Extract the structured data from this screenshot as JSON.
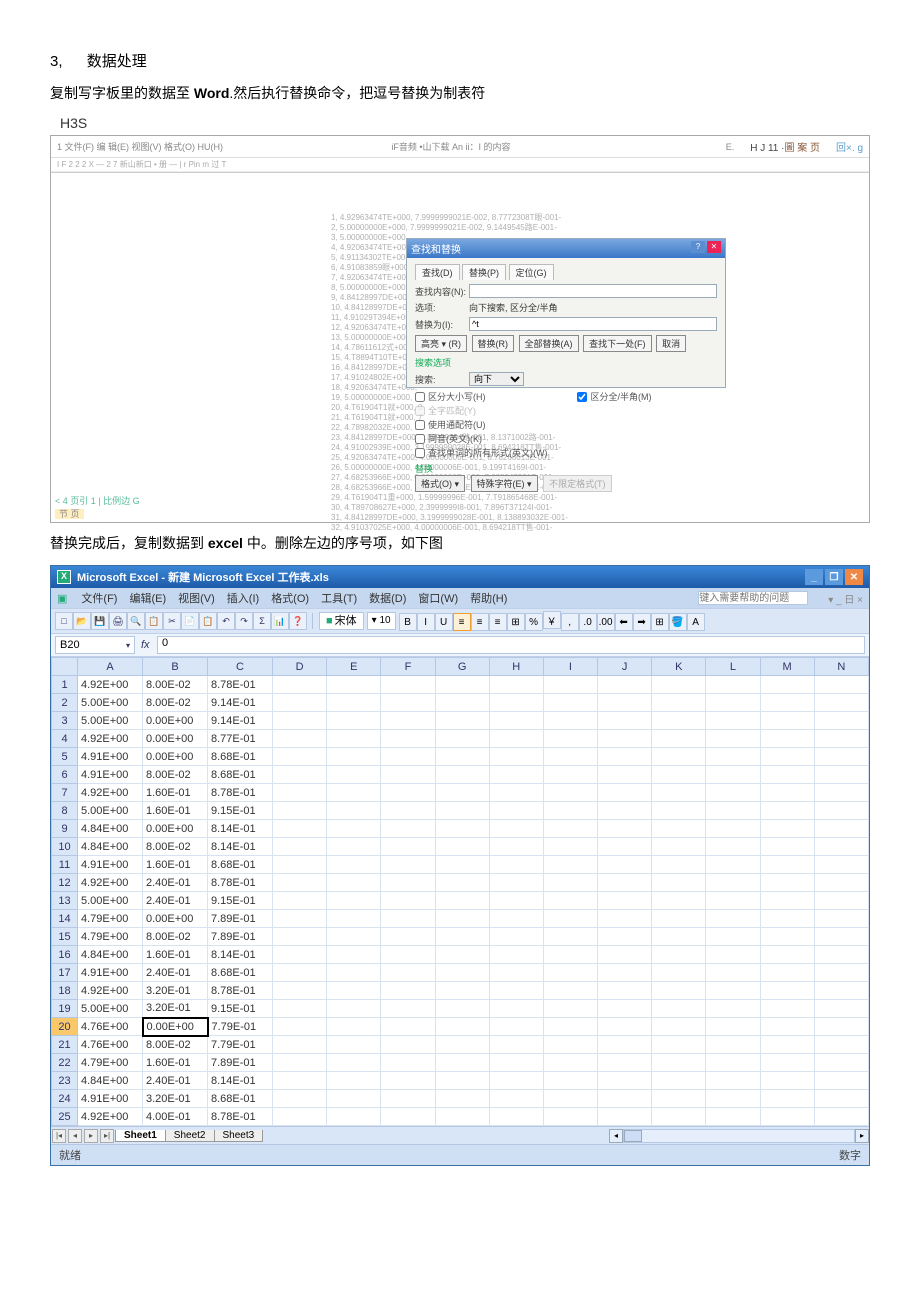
{
  "heading": {
    "num": "3,",
    "text": "数据处理"
  },
  "para1": {
    "a": "复制写字板里的数据至 ",
    "b": "Word",
    "c": ".然后执行替换命令，把逗号替换为制表符"
  },
  "h3s": "H3S",
  "word": {
    "menu_left": "1 文件(F)    编 辑(E) 视图(V) 格式(O) HU(H)",
    "menu_mid": "iF音频   •山下载   An ii：I 的内容",
    "menu_sub": "I F 2 2 2 X — 2 7 新山新口 • 册 — | r Pin m 过 T",
    "hj": "H J 11 ·",
    "hj2": "圖 案  页",
    "g": "回×. g",
    "e": "E.",
    "text_lines": [
      "1, 4.92963474TE+000, 7.9999999021E-002, 8.7772308T眼-001-",
      "2, 5.00000000E+000, 7.9999999021E-002, 9.1449545路E-001-",
      "3, 5.00000000E+000,",
      "4, 4.92063474TE+000, 0",
      "5, 4.91134302TE+000, 0",
      "6, 4.91083859眼+000, 7",
      "7, 4.92063474TE+000, 7",
      "8, 5.00000000E+000, 1",
      "9, 4.84128997DE+000, 0",
      "10, 4.84128997DE+000, 7",
      "11, 4.91029T394E+000, 1",
      "12, 4.92063474TE+000, 2",
      "13, 5.00000000E+000, 2",
      "14, 4.78611612式+000, 0",
      "15, 4.T8894T10TE+000, 7",
      "16, 4.84128997DE+000, 1",
      "17, 4.91024802E+000, 2",
      "18, 4.92063474TE+000,",
      "19, 5.00000000E+000,",
      "20, 4.T61904T1就+000, 0",
      "21, 4.T61904T1就+000, 7",
      "22, 4.78982032E+000, 1",
      "23, 4.84128997DE+000, 2.39999994路-001, 8.1371002路-001-",
      "24, 4.91002939E+000, 3.1999999028E-001, 8.694218TT售-001-",
      "25, 4.92063474TE+000, 4.00000006E-001, 8.78268613E-001-",
      "26, 5.00000000E+000, 4.00000006E-001, 9.199T4169I-001-",
      "27, 4.68253966E+000, 0.00000000E+000, 7.688042521E-001-",
      "28, 4.68253966E+000, 7.9999999021E-002, 7.689824T2E-001-",
      "29, 4.T61904T1重+000, 1.59999996E-001, 7.T91865468E-001-",
      "30, 4.T89708627E+000, 2.3999999I8-001, 7.896T37124I-001-",
      "31, 4.84128997DE+000, 3.1999999028E-001, 8.138893032E-001-",
      "32, 4.91037025E+000, 4.00000006E-001, 8.694218TT售-001-"
    ],
    "dlg": {
      "title": "查找和替换",
      "tabs": [
        "查找(D)",
        "替换(P)",
        "定位(G)"
      ],
      "find_lbl": "查找内容(N):",
      "opt_lbl": "选项:",
      "opt_val": "向下搜索, 区分全/半角",
      "repl_lbl": "替换为(I):",
      "repl_val": "^t",
      "btns": [
        "高亮 ▾ (R)",
        "替换(R)",
        "全部替换(A)",
        "查找下一处(F)",
        "取消"
      ],
      "more": "搜索选项",
      "search": "搜索:",
      "search_opt": "向下",
      "chk1": "区分大小写(H)",
      "chk1a": "全字匹配(Y)",
      "chk2": "使用通配符(U)",
      "chk3": "同音(英文)(K)",
      "chk4": "查找单词的所有形式(英文)(W)",
      "chk5": "区分全/半角(M)",
      "sub": "替换",
      "bbtns": [
        "格式(O) ▾",
        "特殊字符(E) ▾",
        "不限定格式(T)"
      ]
    },
    "footer": "< 4 页引 1 | 比例边 G",
    "footer2": "节 页"
  },
  "para2": {
    "a": "替换完成后，复制数据到 ",
    "b": "excel",
    "c": " 中。删除左边的序号项，如下图"
  },
  "excel": {
    "title": "Microsoft Excel - 新建 Microsoft Excel 工作表.xls",
    "menus": [
      "文件(F)",
      "编辑(E)",
      "视图(V)",
      "插入(I)",
      "格式(O)",
      "工具(T)",
      "数据(D)",
      "窗口(W)",
      "帮助(H)"
    ],
    "help_hint": "键入需要帮助的问题",
    "menu_right": "▾ _ 日 ×",
    "toolbar_icons": [
      "□",
      "📂",
      "💾",
      "🖨",
      "🔍",
      "📋",
      "✂",
      "📄",
      "📋",
      "↶",
      "↷",
      "Σ",
      "📊",
      "❓"
    ],
    "font_name": "宋体",
    "font_size": "10",
    "fmt_icons": [
      "B",
      "I",
      "U",
      "≡",
      "≡",
      "≡",
      "⊞",
      "%",
      "￥",
      ",",
      ".0",
      ".00",
      "⬅",
      "➡",
      "⊞",
      "🪣",
      "A"
    ],
    "namebox": "B20",
    "fx": "fx",
    "formula": "0",
    "cols": [
      "A",
      "B",
      "C",
      "D",
      "E",
      "F",
      "G",
      "H",
      "I",
      "J",
      "K",
      "L",
      "M",
      "N"
    ],
    "rows": [
      {
        "n": "1",
        "a": "4.92E+00",
        "b": "8.00E-02",
        "c": "8.78E-01"
      },
      {
        "n": "2",
        "a": "5.00E+00",
        "b": "8.00E-02",
        "c": "9.14E-01"
      },
      {
        "n": "3",
        "a": "5.00E+00",
        "b": "0.00E+00",
        "c": "9.14E-01"
      },
      {
        "n": "4",
        "a": "4.92E+00",
        "b": "0.00E+00",
        "c": "8.77E-01"
      },
      {
        "n": "5",
        "a": "4.91E+00",
        "b": "0.00E+00",
        "c": "8.68E-01"
      },
      {
        "n": "6",
        "a": "4.91E+00",
        "b": "8.00E-02",
        "c": "8.68E-01"
      },
      {
        "n": "7",
        "a": "4.92E+00",
        "b": "1.60E-01",
        "c": "8.78E-01"
      },
      {
        "n": "8",
        "a": "5.00E+00",
        "b": "1.60E-01",
        "c": "9.15E-01"
      },
      {
        "n": "9",
        "a": "4.84E+00",
        "b": "0.00E+00",
        "c": "8.14E-01"
      },
      {
        "n": "10",
        "a": "4.84E+00",
        "b": "8.00E-02",
        "c": "8.14E-01"
      },
      {
        "n": "11",
        "a": "4.91E+00",
        "b": "1.60E-01",
        "c": "8.68E-01"
      },
      {
        "n": "12",
        "a": "4.92E+00",
        "b": "2.40E-01",
        "c": "8.78E-01"
      },
      {
        "n": "13",
        "a": "5.00E+00",
        "b": "2.40E-01",
        "c": "9.15E-01"
      },
      {
        "n": "14",
        "a": "4.79E+00",
        "b": "0.00E+00",
        "c": "7.89E-01"
      },
      {
        "n": "15",
        "a": "4.79E+00",
        "b": "8.00E-02",
        "c": "7.89E-01"
      },
      {
        "n": "16",
        "a": "4.84E+00",
        "b": "1.60E-01",
        "c": "8.14E-01"
      },
      {
        "n": "17",
        "a": "4.91E+00",
        "b": "2.40E-01",
        "c": "8.68E-01"
      },
      {
        "n": "18",
        "a": "4.92E+00",
        "b": "3.20E-01",
        "c": "8.78E-01"
      },
      {
        "n": "19",
        "a": "5.00E+00",
        "b": "3.20E-01",
        "c": "9.15E-01"
      },
      {
        "n": "20",
        "a": "4.76E+00",
        "b": "0.00E+00",
        "c": "7.79E-01"
      },
      {
        "n": "21",
        "a": "4.76E+00",
        "b": "8.00E-02",
        "c": "7.79E-01"
      },
      {
        "n": "22",
        "a": "4.79E+00",
        "b": "1.60E-01",
        "c": "7.89E-01"
      },
      {
        "n": "23",
        "a": "4.84E+00",
        "b": "2.40E-01",
        "c": "8.14E-01"
      },
      {
        "n": "24",
        "a": "4.91E+00",
        "b": "3.20E-01",
        "c": "8.68E-01"
      },
      {
        "n": "25",
        "a": "4.92E+00",
        "b": "4.00E-01",
        "c": "8.78E-01"
      }
    ],
    "tabs": [
      "Sheet1",
      "Sheet2",
      "Sheet3"
    ],
    "status": "就绪",
    "status_r": "数字"
  }
}
